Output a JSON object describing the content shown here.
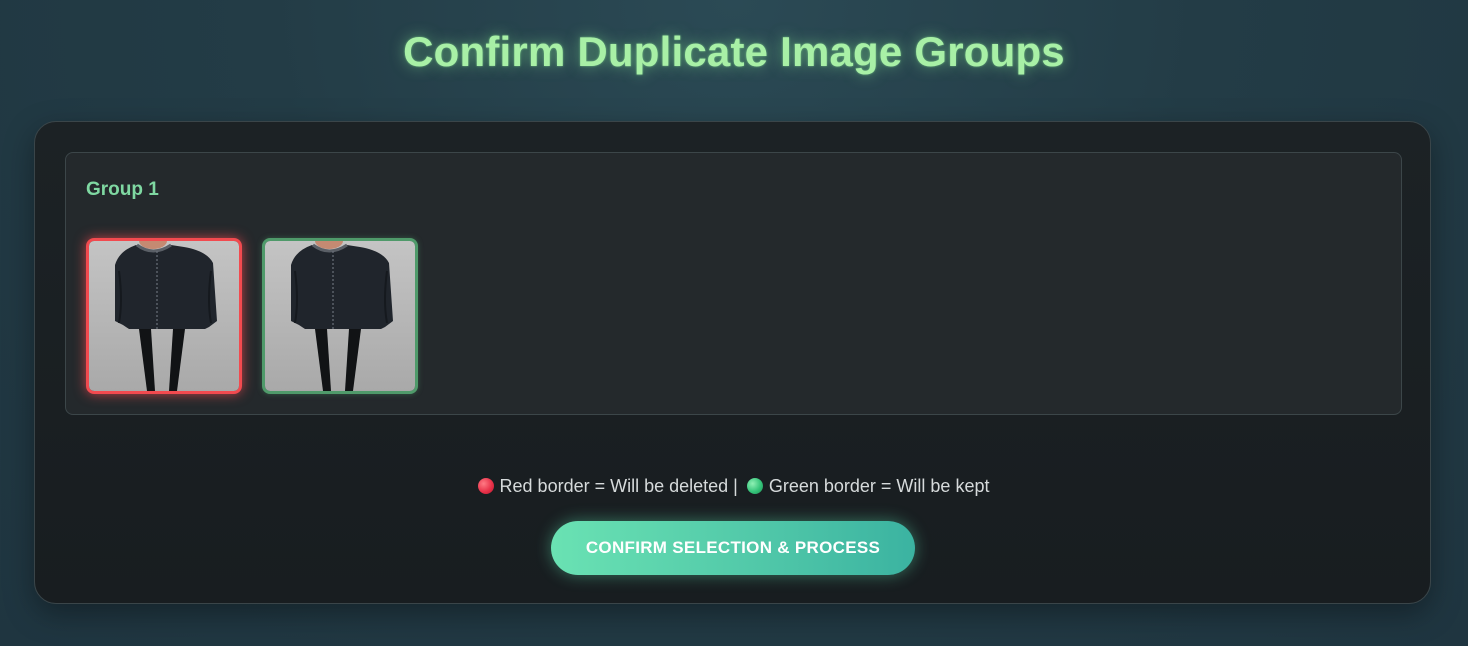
{
  "page": {
    "title": "Confirm Duplicate Image Groups"
  },
  "groups": [
    {
      "title": "Group 1",
      "images": [
        {
          "status": "delete",
          "border_color": "#f24a4f",
          "icon": "jacket-photo"
        },
        {
          "status": "keep",
          "border_color": "#4f9a6a",
          "icon": "jacket-photo"
        }
      ]
    }
  ],
  "legend": {
    "red_text": "Red border = Will be deleted |",
    "green_text": "Green border = Will be kept",
    "red_color": "#e8334a",
    "green_color": "#35c47a"
  },
  "actions": {
    "confirm_label": "CONFIRM SELECTION & PROCESS"
  },
  "colors": {
    "title": "#a8f0a6",
    "accent": "#52c9a9"
  }
}
